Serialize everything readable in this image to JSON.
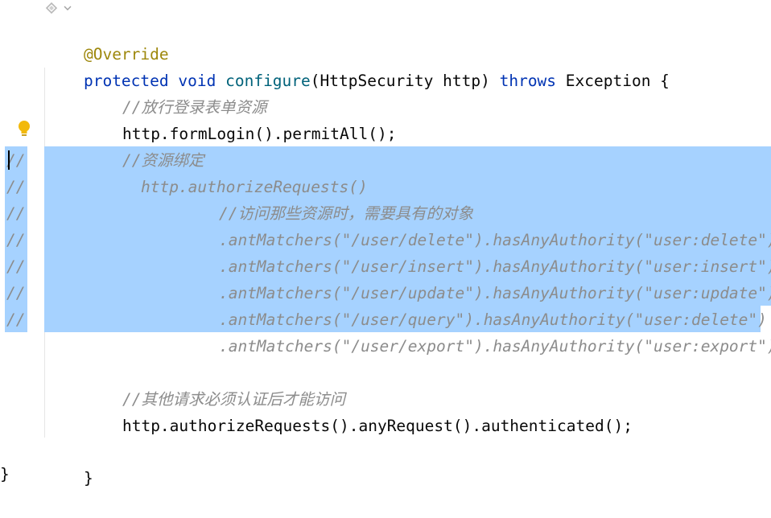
{
  "code": {
    "l1_annotation": "@Override",
    "l2_protected": "protected",
    "l2_void": "void",
    "l2_method": "configure",
    "l2_open": "(HttpSecurity http) ",
    "l2_throws": "throws",
    "l2_rest": " Exception {",
    "l3_comment": "//放行登录表单资源",
    "l4_code": "http.formLogin().permitAll();",
    "l5_comment": "//资源绑定",
    "l6_code": "http.authorizeRequests()",
    "l7_comment": "//访问那些资源时，需要具有的对象",
    "l8_code": ".antMatchers(\"/user/delete\").hasAnyAuthority(\"user:delete\")",
    "l9_code": ".antMatchers(\"/user/insert\").hasAnyAuthority(\"user:insert\")",
    "l10_code": ".antMatchers(\"/user/update\").hasAnyAuthority(\"user:update\")",
    "l11_code": ".antMatchers(\"/user/query\").hasAnyAuthority(\"user:delete\")",
    "l12_code": ".antMatchers(\"/user/export\").hasAnyAuthority(\"user:export\");",
    "l14_comment": "//其他请求必须认证后才能访问",
    "l15_code": "http.authorizeRequests().anyRequest().authenticated();",
    "l17_brace": "}",
    "l18_brace": "}",
    "comment_prefix": "//"
  },
  "colors": {
    "selection": "#a6d2ff",
    "keyword": "#0033b3",
    "annotation": "#9e880d",
    "comment": "#8c8c8c"
  },
  "icons": {
    "top": "ai-assistant-icon",
    "gutter": "lightbulb-icon"
  }
}
